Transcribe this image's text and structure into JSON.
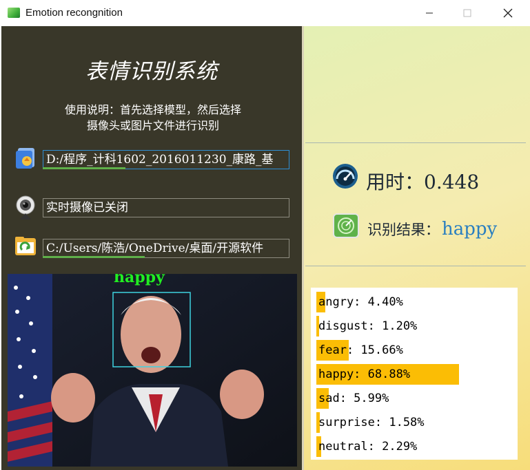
{
  "window": {
    "title": "Emotion recongnition"
  },
  "left": {
    "app_title": "表情识别系统",
    "instructions_line1": "使用说明：首先选择模型，然后选择",
    "instructions_line2": "摄像头或图片文件进行识别",
    "model_path": "D:/程序_计科1602_2016011230_康路_基",
    "camera_status": "实时摄像已关闭",
    "image_path": "C:/Users/陈浩/OneDrive/桌面/开源软件",
    "detected_label": "happy"
  },
  "right": {
    "time_text": "用时：0.448",
    "result_label": "识别结果：",
    "result_value": "happy"
  },
  "chart_data": {
    "type": "bar",
    "orientation": "horizontal",
    "categories": [
      "angry",
      "disgust",
      "fear",
      "happy",
      "sad",
      "surprise",
      "neutral"
    ],
    "values": [
      4.4,
      1.2,
      15.66,
      68.88,
      5.99,
      1.58,
      2.29
    ],
    "labels": [
      "angry: 4.40%",
      "disgust: 1.20%",
      "fear: 15.66%",
      "happy: 68.88%",
      "sad: 5.99%",
      "surprise: 1.58%",
      "neutral: 2.29%"
    ],
    "bar_color": "#fbbd05"
  },
  "colors": {
    "left_bg": "#393729",
    "accent_blue": "#2e8fd6",
    "progress_green": "#5fb04a",
    "face_box": "#3fd3e0",
    "detected_text": "#22ee22"
  }
}
